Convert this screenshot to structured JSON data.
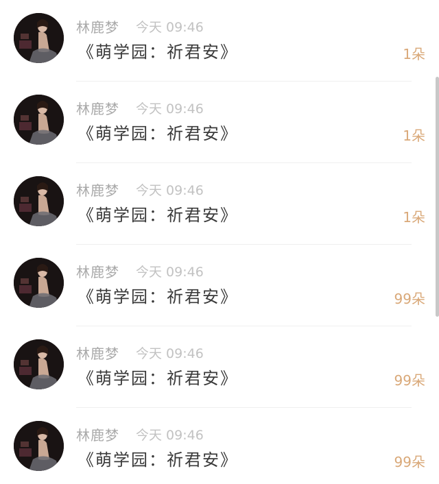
{
  "rows": [
    {
      "name": "林鹿梦",
      "time": "今天 09:46",
      "title": "《萌学园：祈君安》",
      "count": "1朵"
    },
    {
      "name": "林鹿梦",
      "time": "今天 09:46",
      "title": "《萌学园：祈君安》",
      "count": "1朵"
    },
    {
      "name": "林鹿梦",
      "time": "今天 09:46",
      "title": "《萌学园：祈君安》",
      "count": "1朵"
    },
    {
      "name": "林鹿梦",
      "time": "今天 09:46",
      "title": "《萌学园：祈君安》",
      "count": "99朵"
    },
    {
      "name": "林鹿梦",
      "time": "今天 09:46",
      "title": "《萌学园：祈君安》",
      "count": "99朵"
    },
    {
      "name": "林鹿梦",
      "time": "今天 09:46",
      "title": "《萌学园：祈君安》",
      "count": "99朵"
    }
  ],
  "colors": {
    "name": "#a9a9a9",
    "time": "#c2c2c2",
    "title": "#3a3a3a",
    "count": "#d9a878"
  },
  "icons": {
    "avatar": "user-photo-avatar"
  }
}
